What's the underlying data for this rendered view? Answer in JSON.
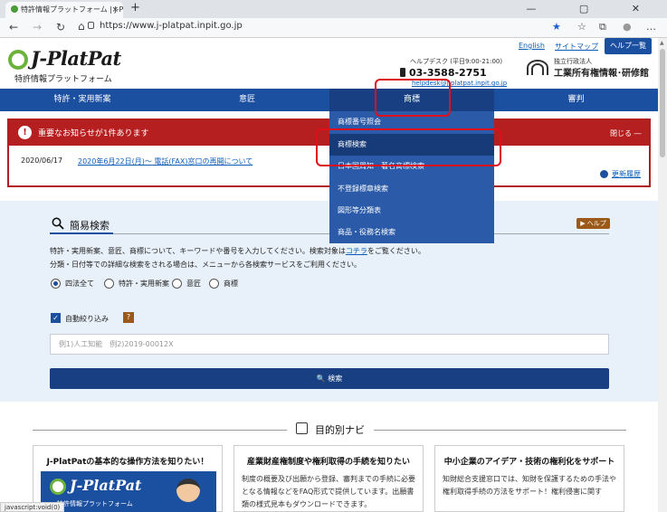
{
  "browser": {
    "tab_title": "特許情報プラットフォーム | J-PlatPat",
    "tab_close": "×",
    "new_tab": "+",
    "window_controls": "— ▢ ✕",
    "nav": {
      "back": "←",
      "forward": "→",
      "reload": "↻",
      "home": "⌂"
    },
    "url": "https://www.j-platpat.inpit.go.jp",
    "toolbar_icons": {
      "star": "★",
      "favorites": "☆",
      "collections": "⧉",
      "account": "●",
      "more": "…"
    }
  },
  "header": {
    "logo_text": "J-PlatPat",
    "logo_sub": "特許情報プラットフォーム",
    "link_english": "English",
    "link_sitemap": "サイトマップ",
    "help_button": "ヘルプ一覧",
    "desk_label": "ヘルプデスク (平日9:00-21:00)",
    "desk_phone": "03-3588-2751",
    "desk_mail": "helpdesk@j-platpat.inpit.go.jp",
    "inpit_small": "独立行政法人",
    "inpit_name": "工業所有権情報･研修館"
  },
  "gnav": [
    {
      "label": "特許・実用新案"
    },
    {
      "label": "意匠"
    },
    {
      "label": "商標"
    },
    {
      "label": "審判"
    }
  ],
  "dropdown": [
    {
      "label": "商標番号照会"
    },
    {
      "label": "商標検索"
    },
    {
      "label": "日本国周知・著名商標検索"
    },
    {
      "label": "不登録標章検索"
    },
    {
      "label": "図形等分類表"
    },
    {
      "label": "商品・役務名検索"
    }
  ],
  "notice": {
    "icon": "!",
    "title": "重要なお知らせが1件あります",
    "close": "閉じる ―",
    "date": "2020/06/17",
    "link": "2020年6月22日(月)～ 電話(FAX)窓口の再開について",
    "history": "更新履歴"
  },
  "search": {
    "title": "簡易検索",
    "help": "▶ ヘルプ",
    "desc1_a": "特許・実用新案、意匠、商標について、キーワードや番号を入力してください。検索対象は",
    "desc1_link": "コチラ",
    "desc1_b": "をご覧ください。",
    "desc2": "分類・日付等での詳細な検索をされる場合は、メニューから各検索サービスをご利用ください。",
    "radios": [
      "四法全て",
      "特許・実用新案",
      "意匠",
      "商標"
    ],
    "checkbox_label": "自動絞り込み",
    "checkbox_mark": "✓",
    "question_mark": "?",
    "input_placeholder": "例1)人工知能　例2)2019-00012X",
    "button": "🔍 検索"
  },
  "purpose_nav": {
    "title": "目的別ナビ",
    "cards": [
      {
        "title": "J-PlatPatの基本的な操作方法を知りたい！",
        "body": "",
        "img_logo": "J-PlatPat",
        "img_sub": "特許情報プラットフォーム"
      },
      {
        "title": "産業財産権制度や権利取得の手続を知りたい",
        "body": "制度の概要及び出願から登録、審判までの手続に必要となる情報などをFAQ形式で提供しています。出願書類の様式見本もダウンロードできます。"
      },
      {
        "title": "中小企業のアイデア・技術の権利化をサポート",
        "body": "知財総合支援窓口では、知財を保護するための手法や権利取得手続の方法をサポート！権利侵害に関す"
      }
    ]
  },
  "status_bar": "javascript:void(0)"
}
